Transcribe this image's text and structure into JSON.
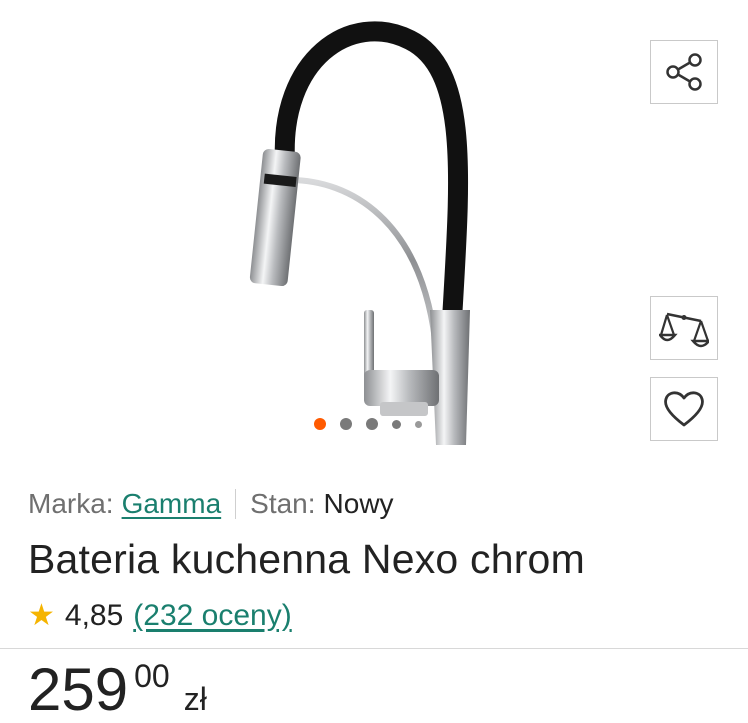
{
  "product": {
    "brand_label": "Marka:",
    "brand_value": "Gamma",
    "condition_label": "Stan:",
    "condition_value": "Nowy",
    "title": "Bateria kuchenna Nexo chrom",
    "rating_value": "4,85",
    "rating_count": "(232 oceny)",
    "price_main": "259",
    "price_cents": "00",
    "price_currency": "zł"
  },
  "gallery": {
    "total_images": 5,
    "active_index": 0
  },
  "actions": [
    {
      "name": "share-button",
      "icon": "share-icon"
    },
    {
      "name": "compare-button",
      "icon": "scales-icon"
    },
    {
      "name": "wishlist-button",
      "icon": "heart-icon"
    }
  ],
  "colors": {
    "accent": "#ff5a00",
    "link": "#1a7f6e",
    "star": "#f5b400",
    "text": "#222222",
    "muted": "#6f6f6f"
  }
}
